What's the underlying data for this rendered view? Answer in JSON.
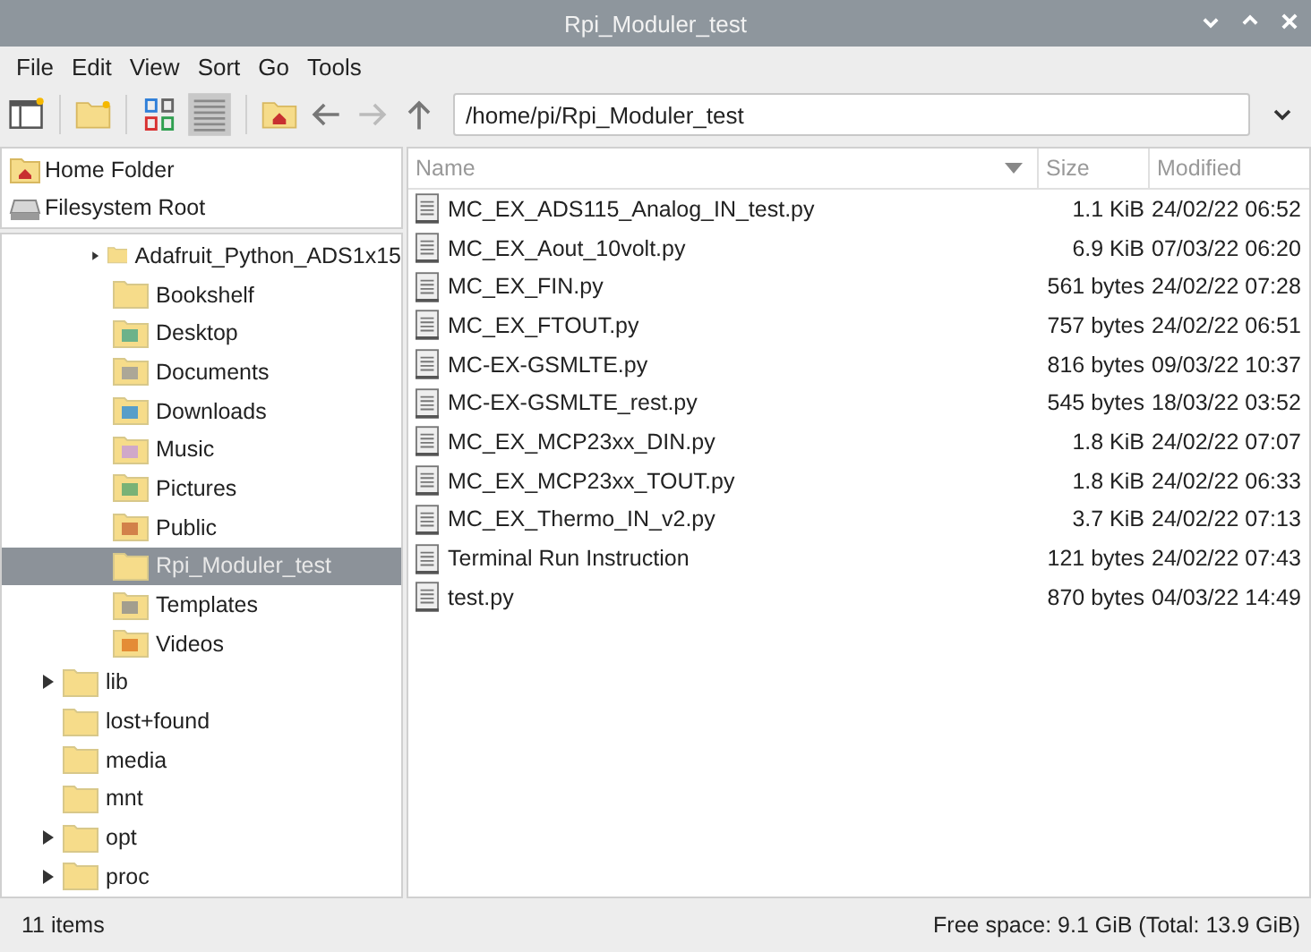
{
  "window": {
    "title": "Rpi_Moduler_test"
  },
  "menu": [
    "File",
    "Edit",
    "View",
    "Sort",
    "Go",
    "Tools"
  ],
  "toolbar": {
    "list_view": true
  },
  "path": {
    "value": "/home/pi/Rpi_Moduler_test"
  },
  "places": [
    {
      "label": "Home Folder",
      "kind": "home"
    },
    {
      "label": "Filesystem Root",
      "kind": "drive"
    }
  ],
  "tree": [
    {
      "children": [
        {
          "label": "Adafruit_Python_ADS1x15",
          "kind": "folder",
          "expandable": true,
          "selected": false
        },
        {
          "label": "Bookshelf",
          "kind": "folder",
          "expandable": false,
          "selected": false
        },
        {
          "label": "Desktop",
          "kind": "desktop",
          "expandable": false,
          "selected": false
        },
        {
          "label": "Documents",
          "kind": "documents",
          "expandable": false,
          "selected": false
        },
        {
          "label": "Downloads",
          "kind": "downloads",
          "expandable": false,
          "selected": false
        },
        {
          "label": "Music",
          "kind": "music",
          "expandable": false,
          "selected": false
        },
        {
          "label": "Pictures",
          "kind": "pictures",
          "expandable": false,
          "selected": false
        },
        {
          "label": "Public",
          "kind": "public",
          "expandable": false,
          "selected": false
        },
        {
          "label": "Rpi_Moduler_test",
          "kind": "folder",
          "expandable": false,
          "selected": true
        },
        {
          "label": "Templates",
          "kind": "templates",
          "expandable": false,
          "selected": false
        },
        {
          "label": "Videos",
          "kind": "videos",
          "expandable": false,
          "selected": false
        }
      ]
    },
    {
      "label": "lib",
      "kind": "folder",
      "expandable": true,
      "selected": false
    },
    {
      "label": "lost+found",
      "kind": "folder",
      "expandable": false,
      "selected": false
    },
    {
      "label": "media",
      "kind": "folder",
      "expandable": false,
      "selected": false
    },
    {
      "label": "mnt",
      "kind": "folder",
      "expandable": false,
      "selected": false
    },
    {
      "label": "opt",
      "kind": "folder",
      "expandable": true,
      "selected": false
    },
    {
      "label": "proc",
      "kind": "folder",
      "expandable": true,
      "selected": false
    }
  ],
  "table": {
    "columns": [
      "Name",
      "Size",
      "Modified"
    ],
    "rows": [
      {
        "name": "MC_EX_ADS115_Analog_IN_test.py",
        "size": "1.1 KiB",
        "modified": "24/02/22 06:52"
      },
      {
        "name": "MC_EX_Aout_10volt.py",
        "size": "6.9 KiB",
        "modified": "07/03/22 06:20"
      },
      {
        "name": "MC_EX_FIN.py",
        "size": "561 bytes",
        "modified": "24/02/22 07:28"
      },
      {
        "name": "MC_EX_FTOUT.py",
        "size": "757 bytes",
        "modified": "24/02/22 06:51"
      },
      {
        "name": "MC-EX-GSMLTE.py",
        "size": "816 bytes",
        "modified": "09/03/22 10:37"
      },
      {
        "name": "MC-EX-GSMLTE_rest.py",
        "size": "545 bytes",
        "modified": "18/03/22 03:52"
      },
      {
        "name": "MC_EX_MCP23xx_DIN.py",
        "size": "1.8 KiB",
        "modified": "24/02/22 07:07"
      },
      {
        "name": "MC_EX_MCP23xx_TOUT.py",
        "size": "1.8 KiB",
        "modified": "24/02/22 06:33"
      },
      {
        "name": "MC_EX_Thermo_IN_v2.py",
        "size": "3.7 KiB",
        "modified": "24/02/22 07:13"
      },
      {
        "name": "Terminal Run Instruction",
        "size": "121 bytes",
        "modified": "24/02/22 07:43"
      },
      {
        "name": "test.py",
        "size": "870 bytes",
        "modified": "04/03/22 14:49"
      }
    ]
  },
  "status_bar": {
    "count": "11 items",
    "free_space": "Free space: 9.1 GiB (Total: 13.9 GiB)"
  }
}
